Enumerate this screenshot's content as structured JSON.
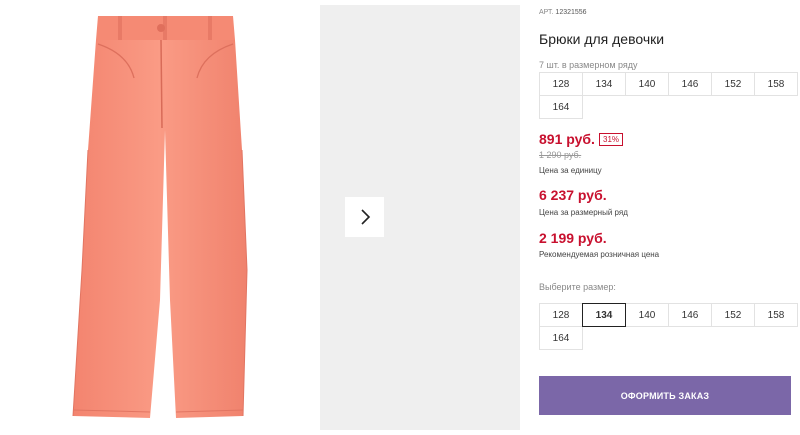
{
  "product": {
    "image_alt": "Брюки для девочки",
    "sku_label": "АРТ.",
    "sku_value": "12321556",
    "title": "Брюки для девочки"
  },
  "gallery": {
    "next_icon": "chevron-right-icon"
  },
  "size_row": {
    "note": "7 шт. в размерном ряду",
    "sizes": [
      "128",
      "134",
      "140",
      "146",
      "152",
      "158",
      "164"
    ]
  },
  "pricing": {
    "unit_price": "891 руб.",
    "discount": "31%",
    "old_price": "1 290 руб.",
    "unit_caption": "Цена за единицу",
    "row_price": "6 237 руб.",
    "row_caption": "Цена за размерный ряд",
    "retail_price": "2 199 руб.",
    "retail_caption": "Рекомендуемая розничная цена"
  },
  "size_select": {
    "label": "Выберите размер:",
    "sizes": [
      "128",
      "134",
      "140",
      "146",
      "152",
      "158",
      "164"
    ],
    "selected": "134"
  },
  "order_button": {
    "label": "ОФОРМИТЬ ЗАКАЗ"
  },
  "colors": {
    "accent": "#7b67a8",
    "price": "#c8102e",
    "pants": "#f78f79"
  }
}
